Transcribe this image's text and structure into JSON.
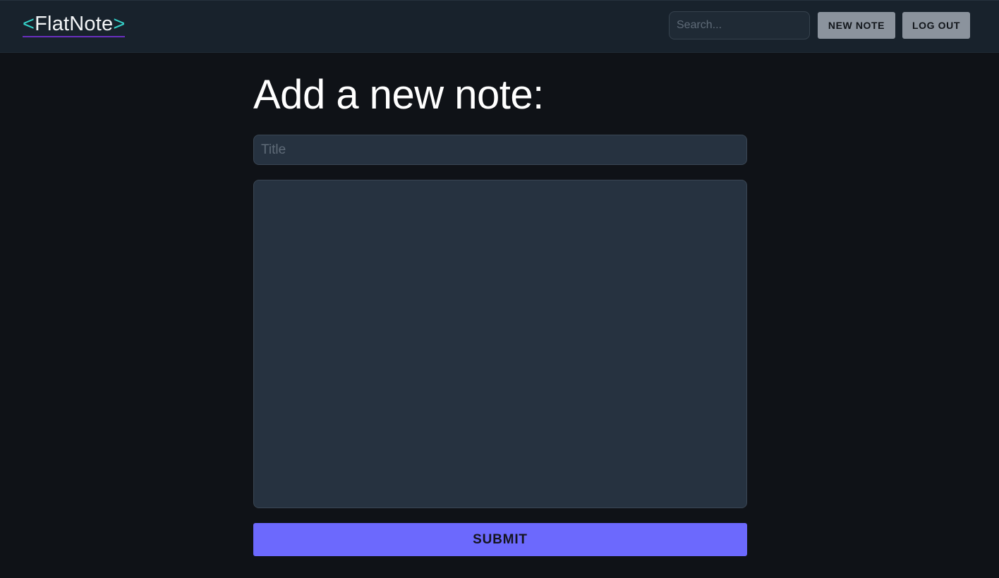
{
  "header": {
    "logo": {
      "open_bracket": "<",
      "name": "FlatNote",
      "close_bracket": ">"
    },
    "search": {
      "placeholder": "Search...",
      "value": ""
    },
    "new_note_label": "NEW NOTE",
    "logout_label": "LOG OUT"
  },
  "main": {
    "heading": "Add a new note:",
    "title_field": {
      "placeholder": "Title",
      "value": ""
    },
    "body_field": {
      "value": ""
    },
    "submit_label": "SUBMIT"
  },
  "colors": {
    "background": "#0f1217",
    "navbar": "#18222c",
    "logo_bracket": "#35d0c8",
    "logo_underline": "#6a2fbf",
    "field_background": "#263240",
    "submit_accent": "#6c69fd",
    "nav_button": "#8b939d"
  }
}
